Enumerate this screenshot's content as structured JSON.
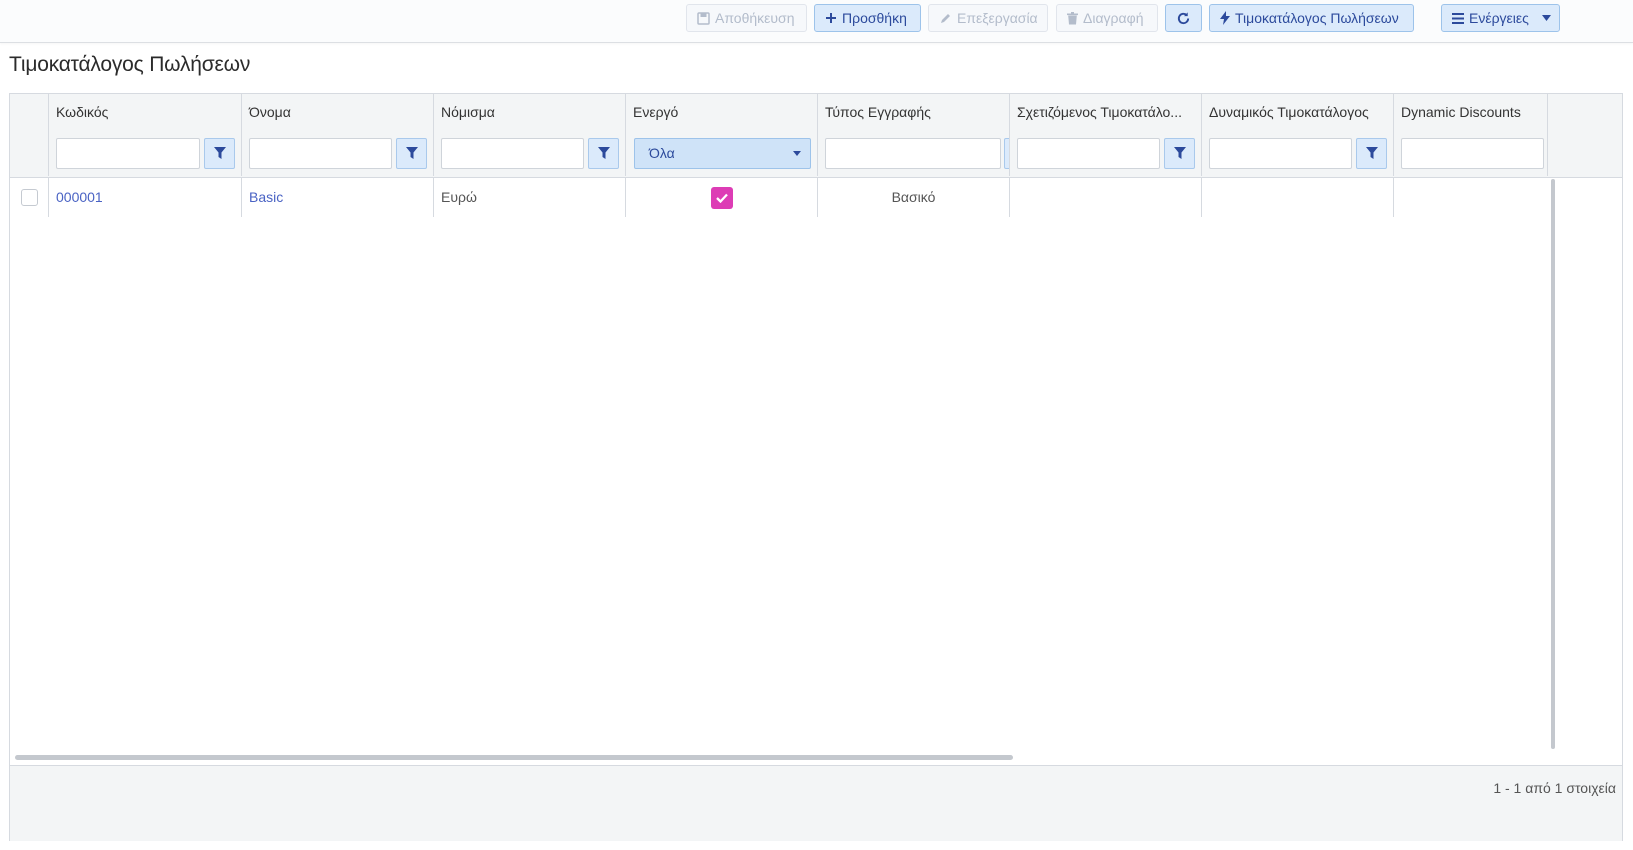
{
  "toolbar": {
    "save_label": "Αποθήκευση",
    "add_label": "Προσθήκη",
    "edit_label": "Επεξεργασία",
    "delete_label": "Διαγραφή",
    "pricelist_label": "Τιμοκατάλογος Πωλήσεων",
    "actions_label": "Ενέργειες"
  },
  "page": {
    "title": "Τιμοκατάλογος Πωλήσεων"
  },
  "grid": {
    "columns": [
      "Κωδικός",
      "Όνομα",
      "Νόμισμα",
      "Ενεργό",
      "Τύπος Εγγραφής",
      "Σχετιζόμενος Τιμοκατάλο...",
      "Δυναμικός Τιμοκατάλογος",
      "Dynamic Discounts"
    ],
    "filter": {
      "active_value": "Όλα"
    },
    "rows": [
      {
        "code": "000001",
        "name": "Basic",
        "currency": "Ευρώ",
        "active": true,
        "record_type": "Βασικό",
        "related_pricelist": "",
        "dynamic_pricelist": "",
        "dynamic_discounts": ""
      }
    ]
  },
  "footer": {
    "pager_info": "1 - 1 από 1 στοιχεία"
  },
  "colors": {
    "primary_bg": "#dbeafb",
    "primary_text": "#2c4a9c",
    "checkbox_active": "#dd3cb5",
    "link": "#4a63c4"
  }
}
